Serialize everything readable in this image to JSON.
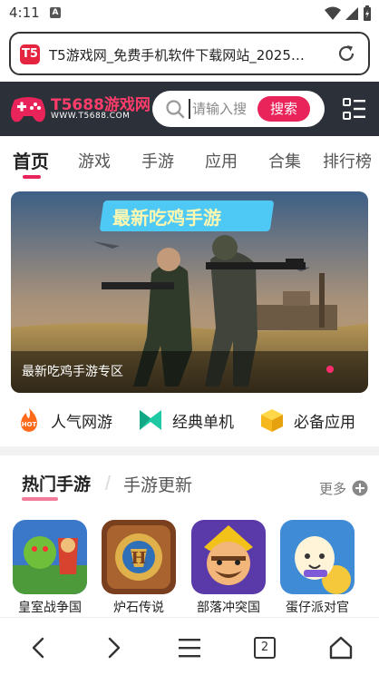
{
  "status_bar": {
    "time": "4:11",
    "notif_badge": "A"
  },
  "url_bar": {
    "text": "T5游戏网_免费手机软件下载网站_2025…",
    "favicon_label": "T5"
  },
  "site": {
    "logo_title": "T5688游戏网",
    "logo_sub": "WWW.T5688.COM",
    "search_placeholder": "请输入搜",
    "search_button": "搜索"
  },
  "tabs": [
    {
      "label": "首页",
      "active": true
    },
    {
      "label": "游戏"
    },
    {
      "label": "手游"
    },
    {
      "label": "应用"
    },
    {
      "label": "合集"
    },
    {
      "label": "排行榜"
    }
  ],
  "banner": {
    "title": "最新吃鸡手游",
    "caption": "最新吃鸡手游专区"
  },
  "quick_links": [
    {
      "label": "人气网游",
      "icon": "hot-fire-icon",
      "icon_text": "HOT"
    },
    {
      "label": "经典单机",
      "icon": "bookmark-icon"
    },
    {
      "label": "必备应用",
      "icon": "cube-icon"
    }
  ],
  "hot_section": {
    "title": "热门手游",
    "title2": "手游更新",
    "more": "更多"
  },
  "games": [
    {
      "name": "皇室战争国",
      "icon": "clash-royale-icon"
    },
    {
      "name": "炉石传说",
      "icon": "hearthstone-icon"
    },
    {
      "name": "部落冲突国",
      "icon": "clash-of-clans-icon"
    },
    {
      "name": "蛋仔派对官",
      "icon": "eggy-party-icon"
    }
  ],
  "bottom_nav": {
    "tab_count": "2"
  },
  "colors": {
    "accent": "#e8245a",
    "header_bg": "#2c3038"
  }
}
